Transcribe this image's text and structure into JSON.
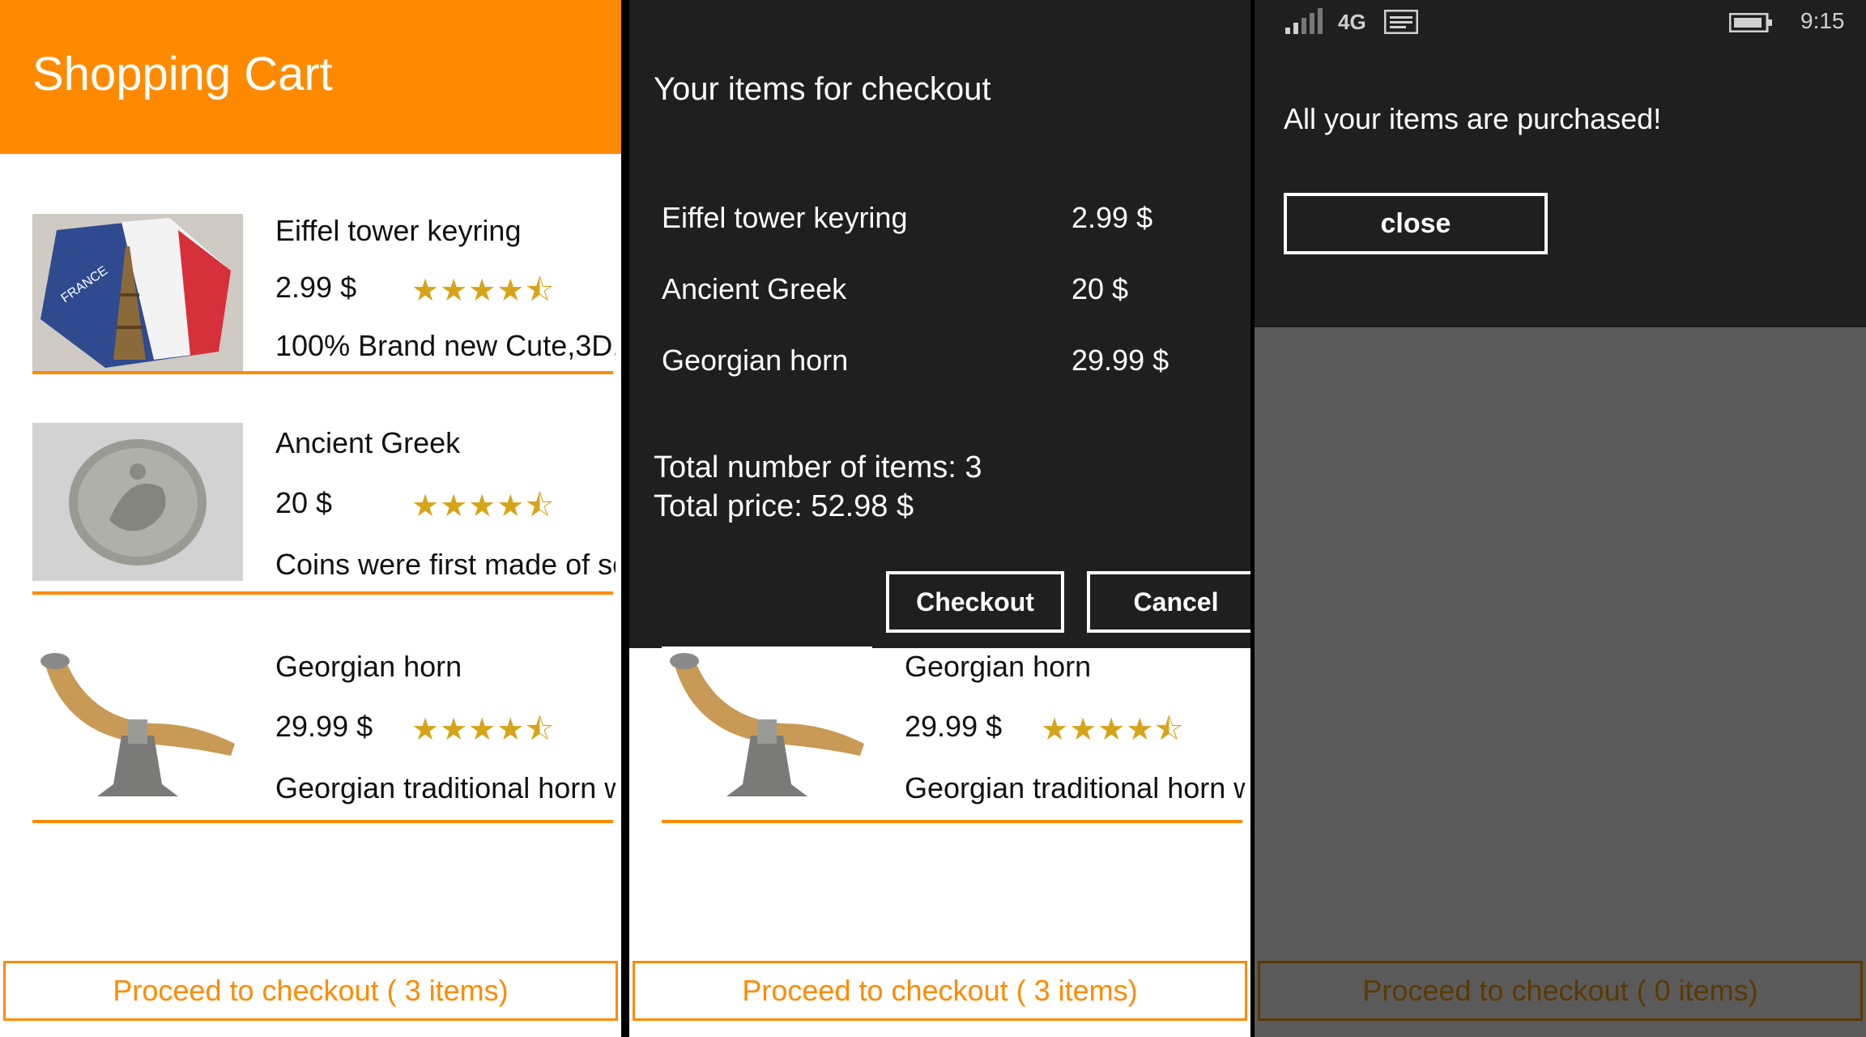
{
  "cart": {
    "title": "Shopping Cart",
    "items": [
      {
        "name": "Eiffel tower keyring",
        "price": "2.99 $",
        "stars": "★★★★⯪",
        "rating": 4.5,
        "description": "100% Brand new Cute,3D,E"
      },
      {
        "name": "Ancient Greek",
        "price": "20 $",
        "stars": "★★★★⯪",
        "rating": 4.5,
        "description": "Coins were first made of sc"
      },
      {
        "name": "Georgian horn",
        "price": "29.99 $",
        "stars": "★★★★⯪",
        "rating": 4.5,
        "description": "Georgian traditional horn w"
      }
    ],
    "checkout_label": "Proceed to checkout ( 3 items)"
  },
  "dialog": {
    "title": "Your items for checkout",
    "rows": [
      {
        "name": "Eiffel tower keyring",
        "price": "2.99 $"
      },
      {
        "name": "Ancient Greek",
        "price": "20 $"
      },
      {
        "name": "Georgian horn",
        "price": "29.99 $"
      }
    ],
    "total_items": "Total number of items: 3",
    "total_price": "Total price: 52.98 $",
    "checkout_btn": "Checkout",
    "cancel_btn": "Cancel"
  },
  "under_dialog_item": {
    "name": "Georgian horn",
    "price": "29.99 $",
    "stars": "★★★★⯪",
    "description": "Georgian traditional horn w"
  },
  "under_dialog_checkout": "Proceed to checkout ( 3 items)",
  "phone": {
    "network": "4G",
    "time": "9:15",
    "message": "All your items are purchased!",
    "close_btn": "close",
    "checkout_label": "Proceed to checkout ( 0 items)",
    "icons": [
      "signal-icon",
      "message-icon",
      "battery-icon"
    ]
  },
  "colors": {
    "accent": "#ff8a00",
    "dialog_bg": "#1f1f1f",
    "dim_bg": "#5a5a5a",
    "star": "#d6a41a"
  }
}
